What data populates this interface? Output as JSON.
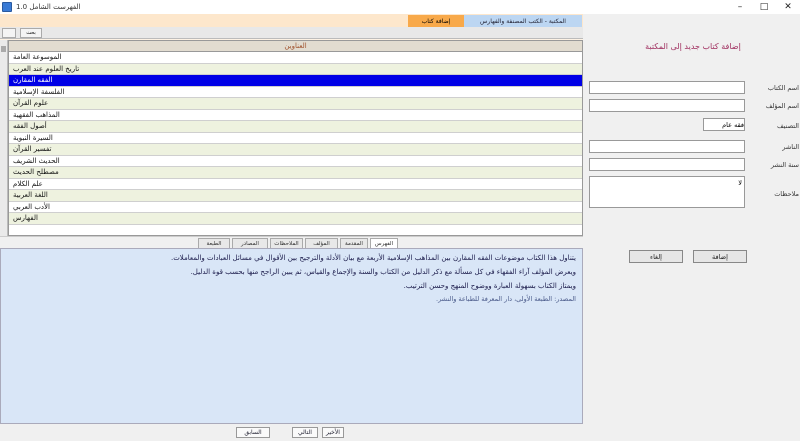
{
  "window": {
    "title": "الفهرست الشامل 1.0"
  },
  "top_tabs": {
    "orange": "إضافة كتاب",
    "blue": "المكتبة - الكتب المصنفة والفهارس"
  },
  "toolbar": {
    "search_label": "بحث"
  },
  "grid": {
    "header": "العناوين",
    "rows": [
      {
        "text": "الموسوعة العامة",
        "style": "a"
      },
      {
        "text": "تاريخ العلوم عند العرب",
        "style": "b"
      },
      {
        "text": "الفقه المقارن",
        "style": "sel"
      },
      {
        "text": "الفلسفة الإسلامية",
        "style": "a"
      },
      {
        "text": "علوم القرآن",
        "style": "b"
      },
      {
        "text": "المذاهب الفقهية",
        "style": "a"
      },
      {
        "text": "أصول الفقه",
        "style": "b"
      },
      {
        "text": "السيرة النبوية",
        "style": "a"
      },
      {
        "text": "تفسير القرآن",
        "style": "b"
      },
      {
        "text": "الحديث الشريف",
        "style": "a"
      },
      {
        "text": "مصطلح الحديث",
        "style": "b"
      },
      {
        "text": "علم الكلام",
        "style": "a"
      },
      {
        "text": "اللغة العربية",
        "style": "b"
      },
      {
        "text": "الأدب العربي",
        "style": "a"
      },
      {
        "text": "الفهارس",
        "style": "b"
      }
    ]
  },
  "lower_tabs": [
    "الفهرس",
    "المقدمة",
    "المؤلف",
    "الملاحظات",
    "المصادر",
    "الطبعة"
  ],
  "content": {
    "paragraphs": [
      "يتناول هذا الكتاب موضوعات الفقه المقارن بين المذاهب الإسلامية الأربعة مع بيان الأدلة والترجيح بين الأقوال في مسائل العبادات والمعاملات.",
      "ويعرض المؤلف آراء الفقهاء في كل مسألة مع ذكر الدليل من الكتاب والسنة والإجماع والقياس، ثم يبين الراجح منها بحسب قوة الدليل.",
      "ويمتاز الكتاب بسهولة العبارة ووضوح المنهج وحسن الترتيب."
    ],
    "footnote": "المصدر: الطبعة الأولى، دار المعرفة للطباعة والنشر."
  },
  "bottom_buttons": [
    "السابق",
    "التالي",
    "الأخير"
  ],
  "right_panel": {
    "title": "إضافة كتاب جديد إلى المكتبة",
    "fields": [
      {
        "label": "اسم الكتاب",
        "value": ""
      },
      {
        "label": "اسم المؤلف",
        "value": ""
      },
      {
        "label": "التصنيف",
        "value": "فقه عام"
      },
      {
        "label": "الناشر",
        "value": ""
      },
      {
        "label": "سنة النشر",
        "value": ""
      }
    ],
    "notes_label": "ملاحظات",
    "notes_value": "لا",
    "add_button": "إضافة",
    "cancel_button": "إلغاء"
  }
}
